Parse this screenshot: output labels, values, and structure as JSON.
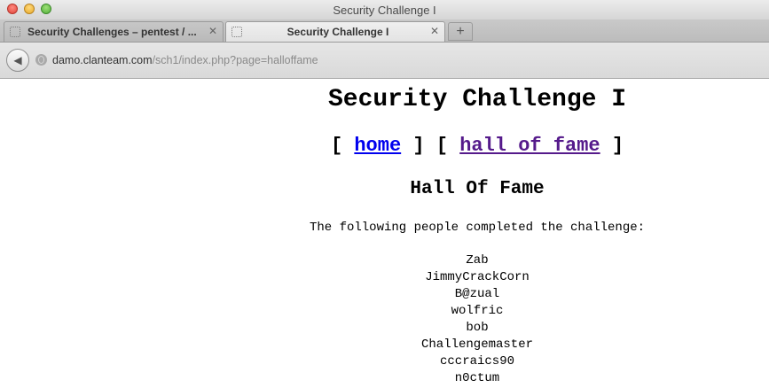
{
  "window": {
    "title": "Security Challenge I"
  },
  "tabs": [
    {
      "label": "Security Challenges – pentest / ...",
      "active": false
    },
    {
      "label": "Security Challenge I",
      "active": true
    }
  ],
  "address": {
    "host": "damo.clanteam.com",
    "path": "/sch1/index.php?page=halloffame"
  },
  "page": {
    "title": "Security Challenge I",
    "nav": {
      "open": "[",
      "close": "]",
      "home": "home",
      "hall_of_fame": "hall of fame"
    },
    "section_title": "Hall Of Fame",
    "intro": "The following people completed the challenge:",
    "people": [
      "Zab",
      "JimmyCrackCorn",
      "B@zual",
      "wolfric",
      "bob",
      "Challengemaster",
      "cccraics90",
      "n0ctum"
    ]
  },
  "colors": {
    "link": "#0000ee",
    "visited_link": "#551a8b"
  },
  "icons": {
    "back": "back-arrow-icon",
    "site": "globe-icon",
    "tab_close": "close-icon",
    "new_tab": "plus-icon"
  }
}
